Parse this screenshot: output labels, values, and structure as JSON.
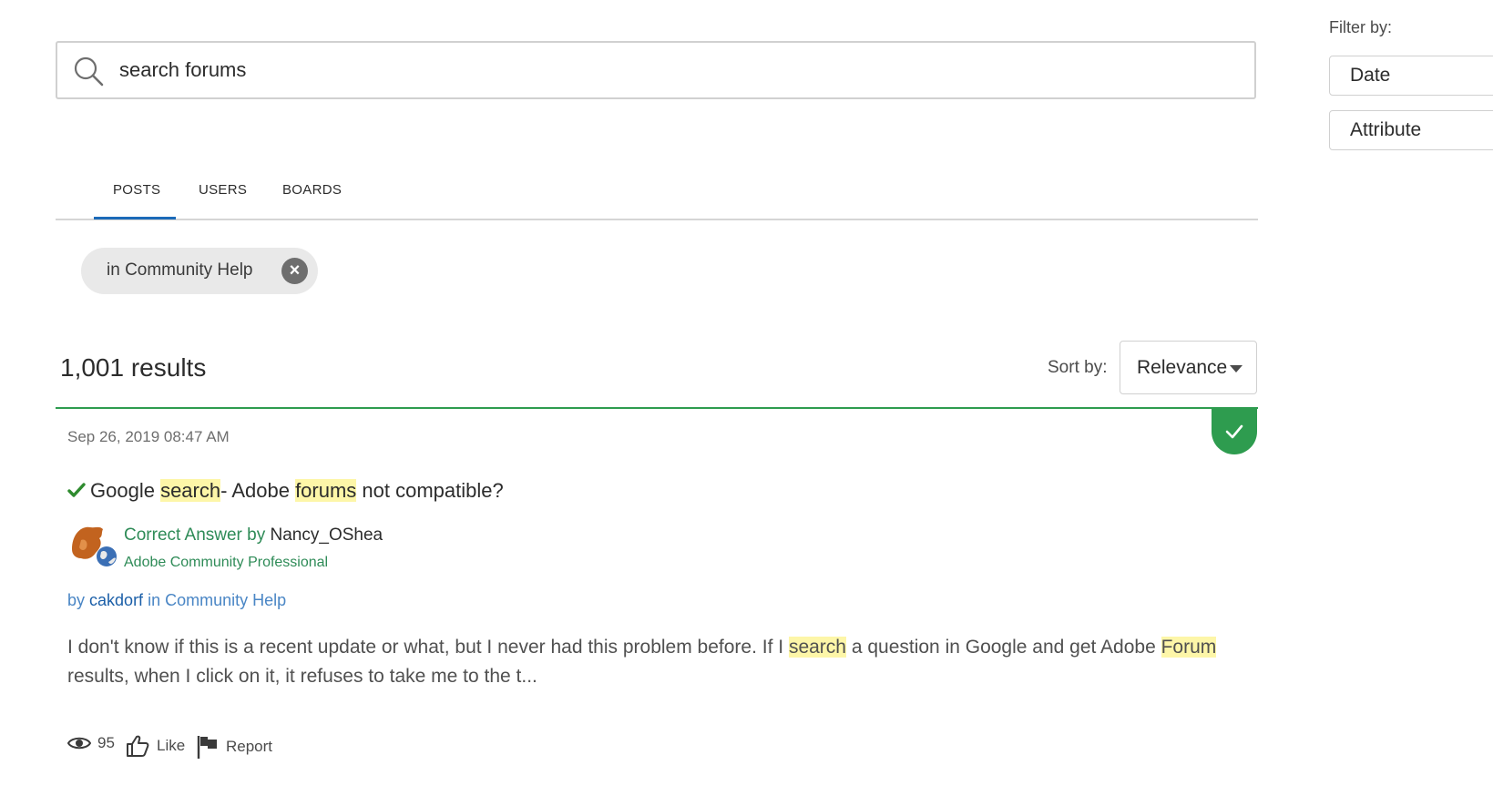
{
  "search": {
    "placeholder": "search forums",
    "value": ""
  },
  "filter": {
    "label": "Filter by:",
    "buttons": [
      "Date",
      "Attribute"
    ]
  },
  "tabs": [
    {
      "label": "POSTS",
      "active": true
    },
    {
      "label": "USERS",
      "active": false
    },
    {
      "label": "BOARDS",
      "active": false
    }
  ],
  "chip": {
    "label": "in Community Help"
  },
  "results": {
    "count": "1,001 results",
    "sort_label": "Sort by:",
    "sort_value": "Relevance"
  },
  "post": {
    "date": "Sep 26, 2019 08:47 AM",
    "title_parts": [
      "Google ",
      "search",
      "- Adobe ",
      "forums",
      " not compatible?"
    ],
    "answer_prefix": "Correct Answer by",
    "answer_author": "Nancy_OShea",
    "answer_rank": "Adobe Community Professional",
    "by_prefix": "by",
    "author": "cakdorf",
    "in_prefix": "in",
    "board": "Community Help",
    "snippet_parts": [
      "I don't know if this is a recent update or what, but I never had this problem before. If I ",
      "search",
      " a question in Google and get Adobe ",
      "Forum",
      " results, when I click on it, it refuses to take me to the t..."
    ],
    "views": "95",
    "like_label": "Like",
    "report_label": "Report"
  },
  "colors": {
    "accent_green": "#2e9c4f",
    "tab_active": "#1b6ab8",
    "highlight": "#fdf6a8",
    "link_blue": "#4a86c5"
  },
  "icons": [
    "search-icon",
    "close-icon",
    "caret-down-icon",
    "checkmark-icon",
    "eye-icon",
    "thumbs-up-icon",
    "flag-icon"
  ]
}
